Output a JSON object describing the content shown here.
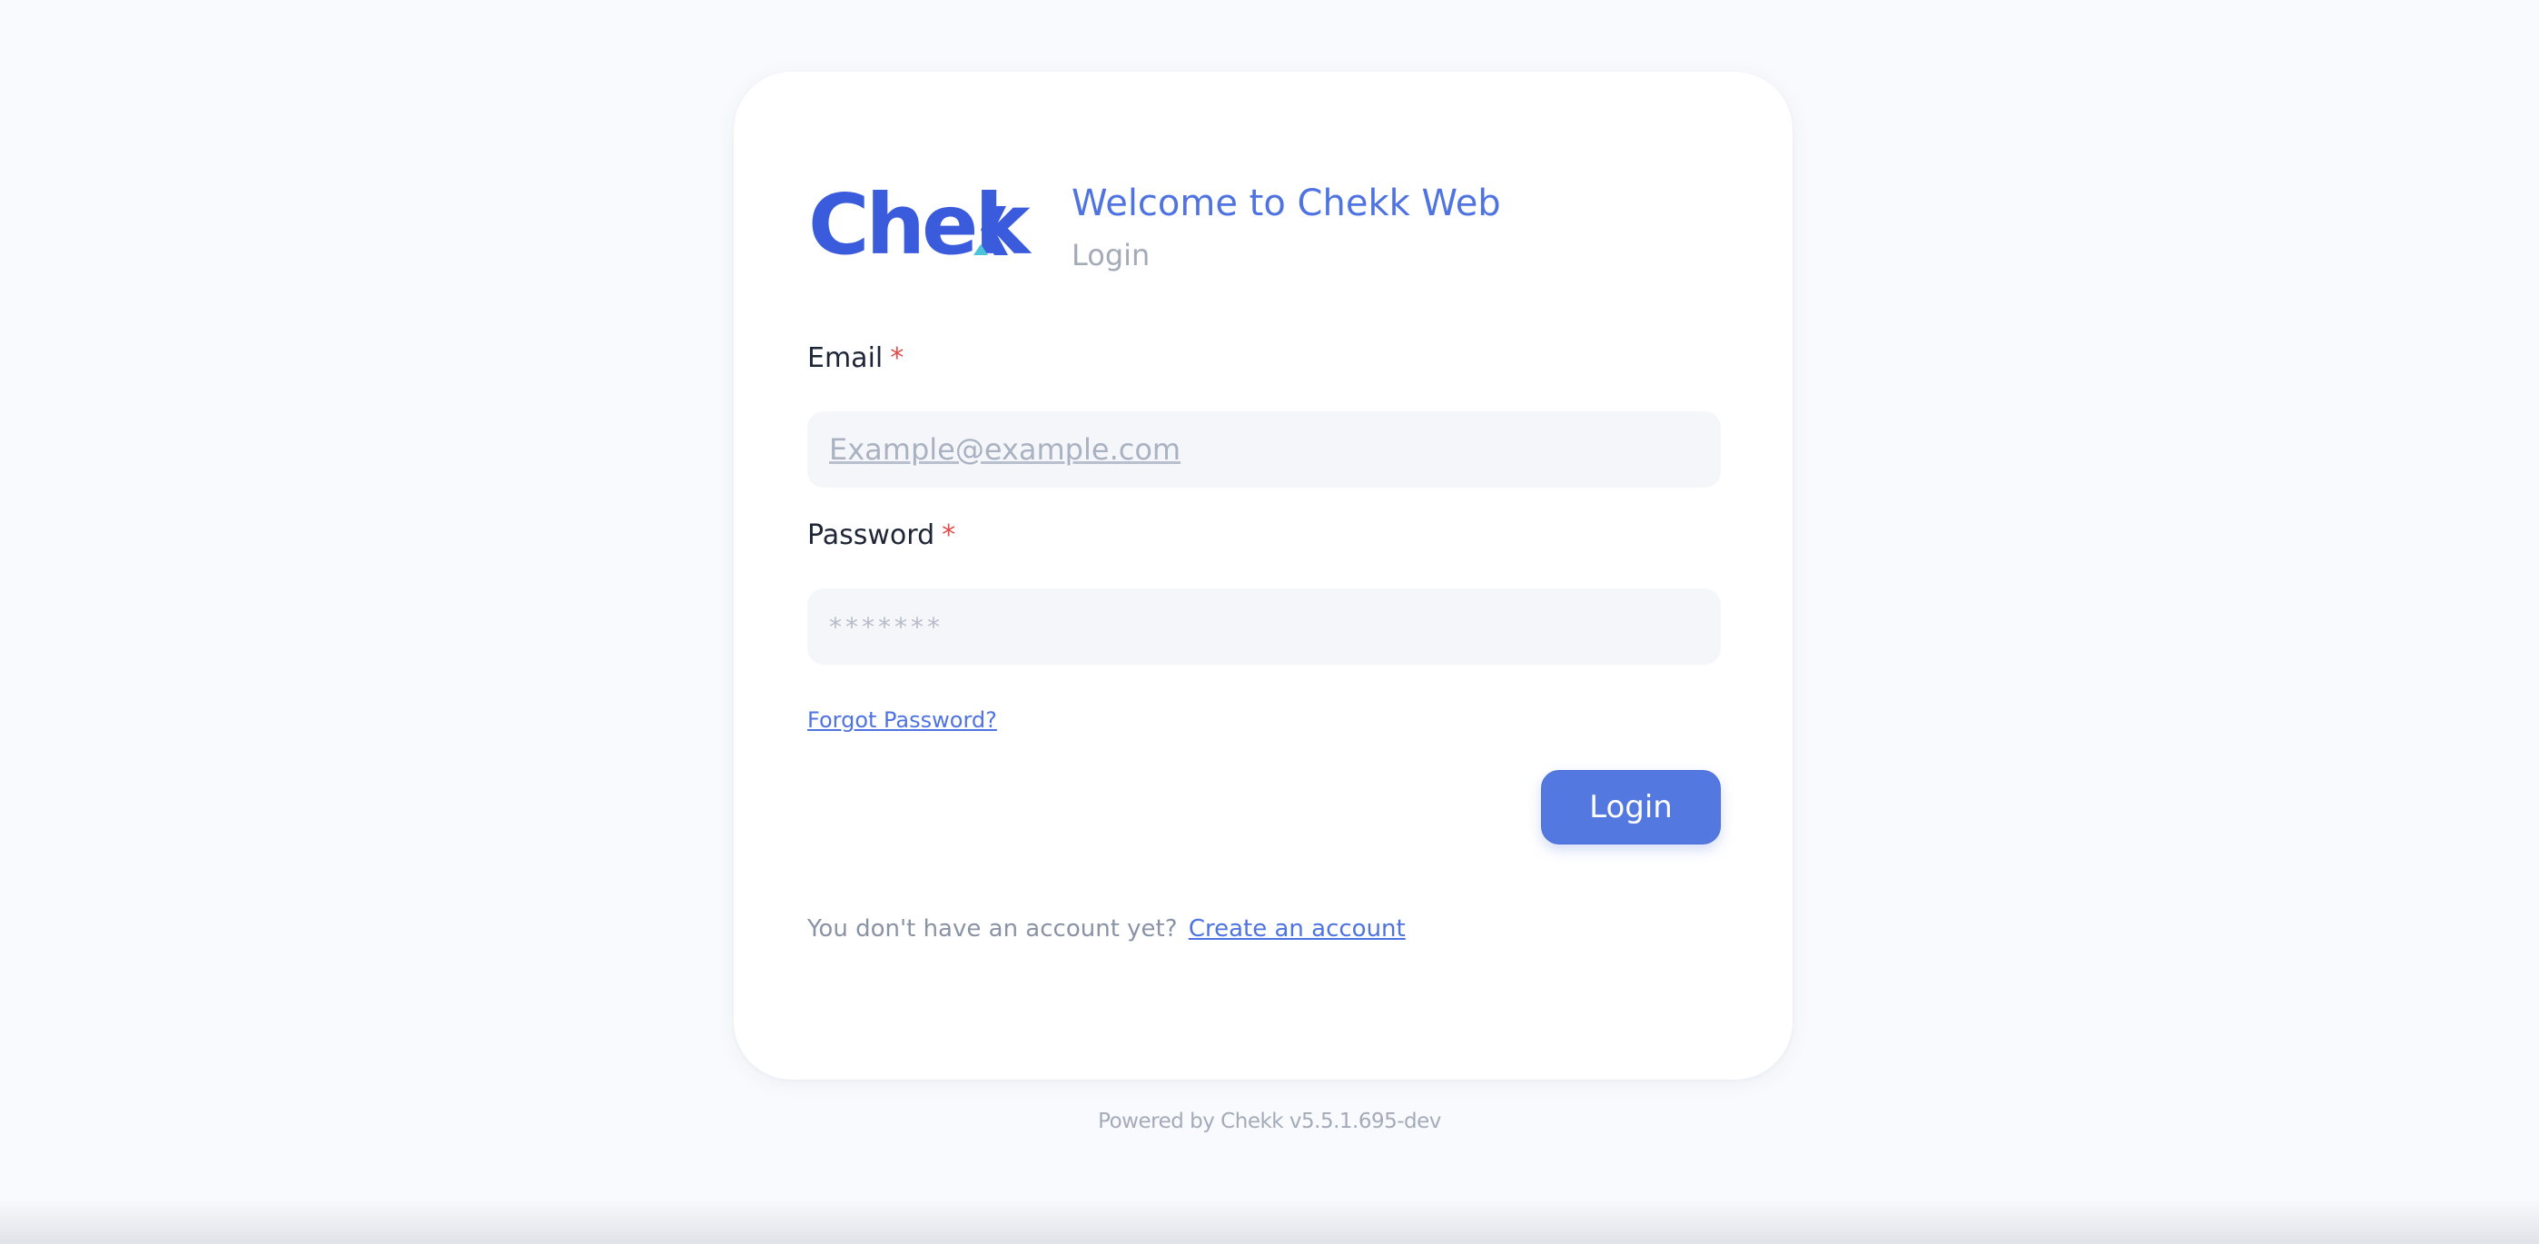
{
  "brand": {
    "logo_text": "Chekk",
    "accent_color": "#3a5bdc",
    "logo_accent_color": "#4cc3d9"
  },
  "header": {
    "title": "Welcome to Chekk Web",
    "subtitle": "Login"
  },
  "form": {
    "email": {
      "label": "Email",
      "required_mark": "*",
      "placeholder": "Example@example.com",
      "value": ""
    },
    "password": {
      "label": "Password",
      "required_mark": "*",
      "placeholder": "*******",
      "value": ""
    },
    "forgot_password_label": "Forgot Password?",
    "login_button_label": "Login"
  },
  "signup": {
    "prompt": "You don't have an account yet?",
    "link_label": "Create an account"
  },
  "footer": {
    "text": "Powered by Chekk v5.5.1.695-dev"
  }
}
